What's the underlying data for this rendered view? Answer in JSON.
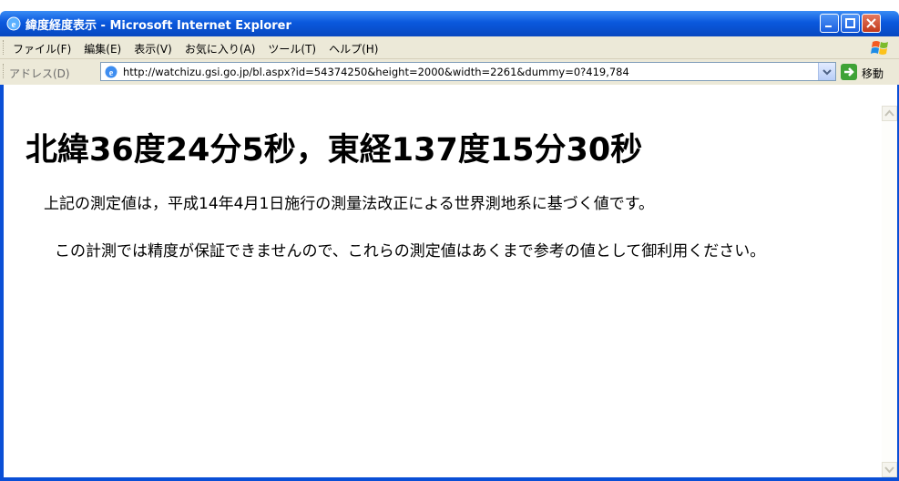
{
  "window": {
    "title": "緯度経度表示 - Microsoft Internet Explorer"
  },
  "menu": {
    "items": [
      "ファイル(F)",
      "編集(E)",
      "表示(V)",
      "お気に入り(A)",
      "ツール(T)",
      "ヘルプ(H)"
    ]
  },
  "address": {
    "label": "アドレス(D)",
    "url": "http://watchizu.gsi.go.jp/bl.aspx?id=54374250&height=2000&width=2261&dummy=0?419,784",
    "go_label": "移動"
  },
  "page": {
    "heading": "北緯36度24分5秒，東経137度15分30秒",
    "paragraph1": "上記の測定値は，平成14年4月1日施行の測量法改正による世界測地系に基づく値です。",
    "paragraph2": "この計測では精度が保証できませんので、これらの測定値はあくまで参考の値として御利用ください。"
  },
  "colors": {
    "titlebar": "#0a58dd",
    "toolbar": "#ece9d8",
    "frame": "#0a4fd6"
  }
}
